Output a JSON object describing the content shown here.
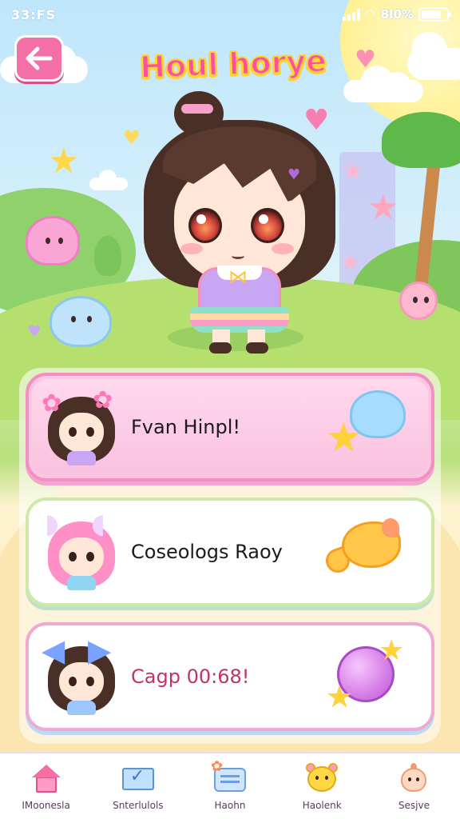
{
  "status_bar": {
    "time": "33:FS",
    "battery_text": "8I0%",
    "battery_level": 0.8
  },
  "header": {
    "back_icon": "arrow-left-icon",
    "title": "Houl horye"
  },
  "list": [
    {
      "label": "Fvan Hinpl!",
      "avatar_icon": "girl-with-flower-buns-avatar",
      "sticker_icon": "cat-blob-with-star-icon"
    },
    {
      "label": "Coseologs Raoy",
      "avatar_icon": "pink-hair-girl-avatar",
      "sticker_icon": "goldfish-icon"
    },
    {
      "label": "Cagp 00:68!",
      "avatar_icon": "girl-with-blue-bow-avatar",
      "sticker_icon": "candy-ball-with-stars-icon"
    }
  ],
  "bottom_nav": [
    {
      "label": "IMoonesla",
      "icon": "home-icon"
    },
    {
      "label": "Snterlulols",
      "icon": "mail-check-icon"
    },
    {
      "label": "Haohn",
      "icon": "chat-icon"
    },
    {
      "label": "Haolenk",
      "icon": "bear-face-icon"
    },
    {
      "label": "Sesjve",
      "icon": "chick-face-icon"
    }
  ],
  "colors": {
    "accent_pink": "#f46fa5",
    "title_pink": "#ff4fa0",
    "title_outline": "#ffd236",
    "card_1_border": "#f48fc4",
    "card_2_border": "#cfe9a8",
    "card_3_text": "#c2326f"
  }
}
